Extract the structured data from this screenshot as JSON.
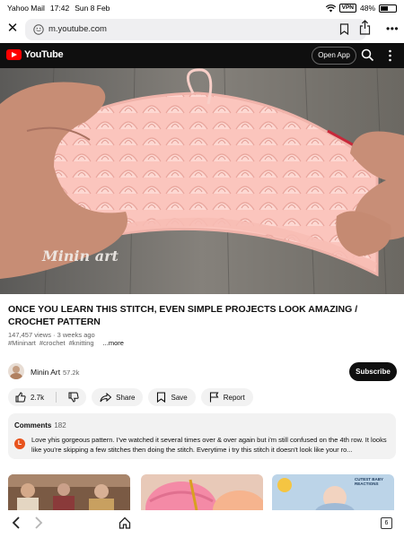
{
  "status_bar": {
    "app": "Yahoo Mail",
    "time": "17:42",
    "date": "Sun 8 Feb",
    "vpn": "VPN",
    "battery": "48%"
  },
  "browser": {
    "url": "m.youtube.com"
  },
  "youtube_header": {
    "brand": "YouTube",
    "open_app": "Open App"
  },
  "video": {
    "watermark": "Minin art",
    "title": "ONCE YOU LEARN THIS STITCH, EVEN SIMPLE PROJECTS LOOK AMAZING / CROCHET PATTERN",
    "meta": "147,457 views · 3 weeks ago",
    "tags": [
      "#Mininart",
      "#crochet",
      "#knitting"
    ],
    "more": "...more"
  },
  "channel": {
    "name": "Minin Art",
    "subscribers": "57.2k",
    "subscribe": "Subscribe"
  },
  "actions": {
    "likes": "2.7k",
    "share": "Share",
    "save": "Save",
    "report": "Report"
  },
  "comments": {
    "label": "Comments",
    "count": "182",
    "avatar_letter": "L",
    "top_comment": "Love yhis gorgeous pattern.  I've watched it several times over & over again but i'm still confused on the 4th row.  It looks like you're skipping a few stitches then doing the stitch.  Everytime i try this stitch it doesn't look like your ro..."
  },
  "recommendations": {
    "third_caption": "CUTEST BABY REACTIONS"
  },
  "bottom_bar": {
    "tab_count": "6"
  },
  "colors": {
    "youtube_red": "#ff0000",
    "header_bg": "#0f0f0f",
    "yarn_pink": "#fbc4bd",
    "comment_avatar": "#e8531d"
  }
}
